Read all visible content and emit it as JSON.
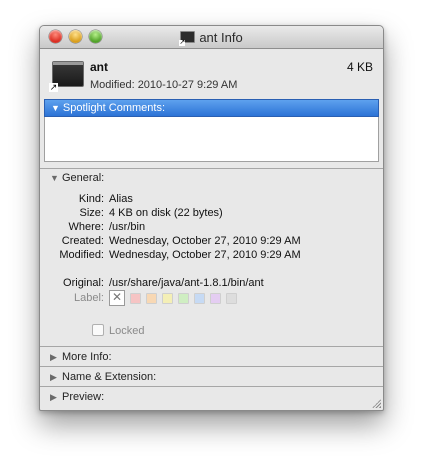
{
  "window": {
    "title": "ant Info"
  },
  "header": {
    "name": "ant",
    "size": "4 KB",
    "modified": "Modified: 2010-10-27 9:29 AM"
  },
  "spotlight": {
    "label": "Spotlight Comments:",
    "text": ""
  },
  "general": {
    "label": "General:",
    "kind_label": "Kind:",
    "kind_value": "Alias",
    "size_label": "Size:",
    "size_value": "4 KB on disk (22 bytes)",
    "where_label": "Where:",
    "where_value": "/usr/bin",
    "created_label": "Created:",
    "created_value": "Wednesday, October 27, 2010 9:29 AM",
    "modified_label": "Modified:",
    "modified_value": "Wednesday, October 27, 2010 9:29 AM",
    "original_label": "Original:",
    "original_value": "/usr/share/java/ant-1.8.1/bin/ant",
    "label_label": "Label:",
    "label_swatch_colors": [
      "#f6c4c4",
      "#f8d8b4",
      "#f4efb6",
      "#cfeec2",
      "#c6daf4",
      "#e4cdf2",
      "#dddddd"
    ],
    "locked_label": "Locked",
    "locked_checked": false
  },
  "sections": {
    "more_info": "More Info:",
    "name_extension": "Name & Extension:",
    "preview": "Preview:"
  },
  "icons": {
    "disclosure_open": "▼",
    "disclosure_closed": "▶",
    "alias_arrow": "↗",
    "no_label": "✕"
  }
}
